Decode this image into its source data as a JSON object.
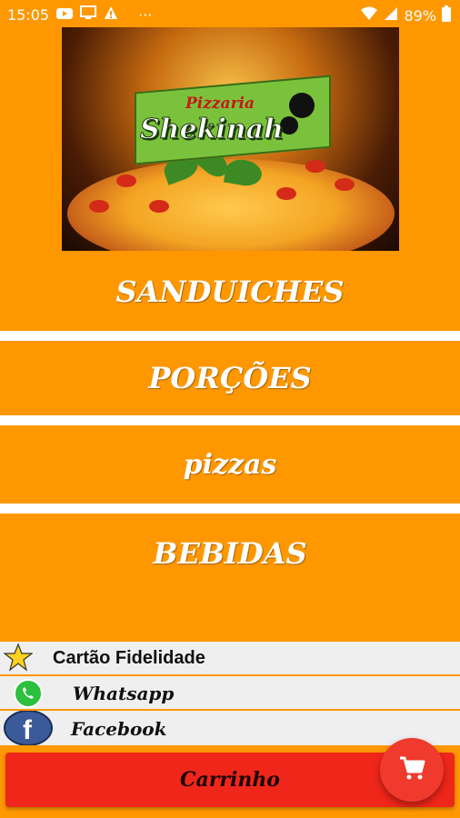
{
  "status_bar": {
    "time": "15:05",
    "battery": "89%",
    "more": "···"
  },
  "hero": {
    "logo_subtitle": "Pizzaria",
    "logo_name": "Shekinah"
  },
  "menu": [
    {
      "label": "SANDUICHES"
    },
    {
      "label": "PORÇÕES"
    },
    {
      "label": "pizzas"
    },
    {
      "label": "BEBIDAS"
    }
  ],
  "links": [
    {
      "label": "Cartão Fidelidade",
      "icon": "star-icon"
    },
    {
      "label": "Whatsapp",
      "icon": "whatsapp-icon"
    },
    {
      "label": "Facebook",
      "icon": "facebook-icon"
    }
  ],
  "cart": {
    "label": "Carrinho"
  },
  "colors": {
    "background": "#FF9800",
    "cart": "#F0261A",
    "list_bg": "#EFEFEF"
  }
}
